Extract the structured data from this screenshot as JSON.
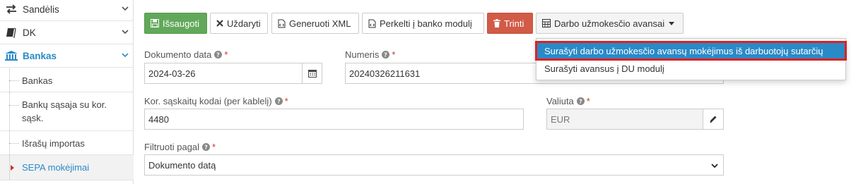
{
  "sidebar": {
    "items": [
      {
        "label": "Sandėlis",
        "icon": "arrows-exchange-icon"
      },
      {
        "label": "DK",
        "icon": "book-icon"
      },
      {
        "label": "Bankas",
        "icon": "bank-icon"
      }
    ],
    "subitems": [
      {
        "label": "Bankas"
      },
      {
        "label": "Bankų sąsaja su kor. sąsk."
      },
      {
        "label": "Išrašų importas"
      },
      {
        "label": "SEPA mokėjimai"
      }
    ]
  },
  "toolbar": {
    "save": "Išsaugoti",
    "close": "Uždaryti",
    "xml": "Generuoti XML",
    "transfer": "Perkelti į banko modulį",
    "delete": "Trinti",
    "advances": "Darbo užmokesčio avansai"
  },
  "menu": {
    "items": [
      "Surašyti darbo užmokesčio avansų mokėjimus iš darbuotojų sutarčių",
      "Surašyti avansus į DU modulį"
    ]
  },
  "form": {
    "doc_date": {
      "label": "Dokumento data",
      "value": "2024-03-26"
    },
    "number": {
      "label": "Numeris",
      "value": "20240326211631"
    },
    "accounts": {
      "label": "Kor. sąskaitų kodai (per kablelį)",
      "value": "4480"
    },
    "currency": {
      "label": "Valiuta",
      "value": "EUR"
    },
    "filter": {
      "label": "Filtruoti pagal",
      "value": "Dokumento datą"
    }
  },
  "colors": {
    "accent": "#2a8ac7",
    "save": "#62a85a",
    "delete": "#d15b47",
    "highlight_border": "#e02020"
  }
}
